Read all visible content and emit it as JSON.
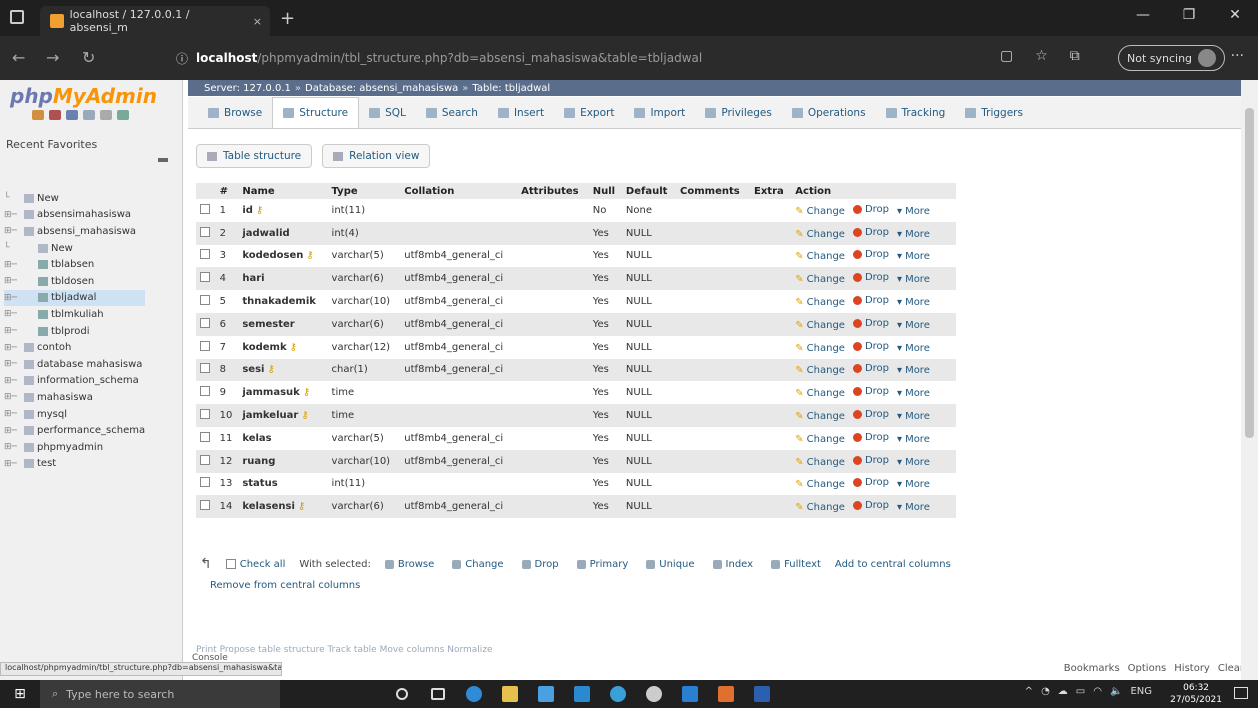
{
  "browser": {
    "tab_title": "localhost / 127.0.0.1 / absensi_m",
    "url_host": "localhost",
    "url_path": "/phpmyadmin/tbl_structure.php?db=absensi_mahasiswa&table=tbljadwal",
    "sync_label": "Not syncing"
  },
  "sidebar": {
    "logo_a": "php",
    "logo_b": "MyAdmin",
    "recent": "Recent",
    "favorites": "Favorites",
    "tree": [
      {
        "label": "New",
        "level": 1,
        "type": "new"
      },
      {
        "label": "absensimahasiswa",
        "level": 1,
        "type": "db"
      },
      {
        "label": "absensi_mahasiswa",
        "level": 1,
        "type": "db"
      },
      {
        "label": "New",
        "level": 2,
        "type": "new"
      },
      {
        "label": "tblabsen",
        "level": 2,
        "type": "tbl"
      },
      {
        "label": "tbldosen",
        "level": 2,
        "type": "tbl"
      },
      {
        "label": "tbljadwal",
        "level": 2,
        "type": "tbl",
        "active": true
      },
      {
        "label": "tblmkuliah",
        "level": 2,
        "type": "tbl"
      },
      {
        "label": "tblprodi",
        "level": 2,
        "type": "tbl"
      },
      {
        "label": "contoh",
        "level": 1,
        "type": "db"
      },
      {
        "label": "database mahasiswa",
        "level": 1,
        "type": "db"
      },
      {
        "label": "information_schema",
        "level": 1,
        "type": "db"
      },
      {
        "label": "mahasiswa",
        "level": 1,
        "type": "db"
      },
      {
        "label": "mysql",
        "level": 1,
        "type": "db"
      },
      {
        "label": "performance_schema",
        "level": 1,
        "type": "db"
      },
      {
        "label": "phpmyadmin",
        "level": 1,
        "type": "db"
      },
      {
        "label": "test",
        "level": 1,
        "type": "db"
      }
    ]
  },
  "breadcrumb": {
    "server": "Server: 127.0.0.1",
    "database": "Database: absensi_mahasiswa",
    "table": "Table: tbljadwal"
  },
  "tabs": [
    "Browse",
    "Structure",
    "SQL",
    "Search",
    "Insert",
    "Export",
    "Import",
    "Privileges",
    "Operations",
    "Tracking",
    "Triggers"
  ],
  "active_tab": "Structure",
  "subtabs": [
    "Table structure",
    "Relation view"
  ],
  "columns": [
    "#",
    "Name",
    "Type",
    "Collation",
    "Attributes",
    "Null",
    "Default",
    "Comments",
    "Extra",
    "Action"
  ],
  "rows": [
    {
      "num": "1",
      "name": "id",
      "key": true,
      "type": "int(11)",
      "collation": "",
      "null": "No",
      "default": "None"
    },
    {
      "num": "2",
      "name": "jadwalid",
      "key": false,
      "type": "int(4)",
      "collation": "",
      "null": "Yes",
      "default": "NULL"
    },
    {
      "num": "3",
      "name": "kodedosen",
      "key": true,
      "type": "varchar(5)",
      "collation": "utf8mb4_general_ci",
      "null": "Yes",
      "default": "NULL"
    },
    {
      "num": "4",
      "name": "hari",
      "key": false,
      "type": "varchar(6)",
      "collation": "utf8mb4_general_ci",
      "null": "Yes",
      "default": "NULL"
    },
    {
      "num": "5",
      "name": "thnakademik",
      "key": false,
      "type": "varchar(10)",
      "collation": "utf8mb4_general_ci",
      "null": "Yes",
      "default": "NULL"
    },
    {
      "num": "6",
      "name": "semester",
      "key": false,
      "type": "varchar(6)",
      "collation": "utf8mb4_general_ci",
      "null": "Yes",
      "default": "NULL"
    },
    {
      "num": "7",
      "name": "kodemk",
      "key": true,
      "type": "varchar(12)",
      "collation": "utf8mb4_general_ci",
      "null": "Yes",
      "default": "NULL"
    },
    {
      "num": "8",
      "name": "sesi",
      "key": true,
      "type": "char(1)",
      "collation": "utf8mb4_general_ci",
      "null": "Yes",
      "default": "NULL"
    },
    {
      "num": "9",
      "name": "jammasuk",
      "key": true,
      "type": "time",
      "collation": "",
      "null": "Yes",
      "default": "NULL"
    },
    {
      "num": "10",
      "name": "jamkeluar",
      "key": true,
      "type": "time",
      "collation": "",
      "null": "Yes",
      "default": "NULL"
    },
    {
      "num": "11",
      "name": "kelas",
      "key": false,
      "type": "varchar(5)",
      "collation": "utf8mb4_general_ci",
      "null": "Yes",
      "default": "NULL"
    },
    {
      "num": "12",
      "name": "ruang",
      "key": false,
      "type": "varchar(10)",
      "collation": "utf8mb4_general_ci",
      "null": "Yes",
      "default": "NULL"
    },
    {
      "num": "13",
      "name": "status",
      "key": false,
      "type": "int(11)",
      "collation": "",
      "null": "Yes",
      "default": "NULL"
    },
    {
      "num": "14",
      "name": "kelasensi",
      "key": true,
      "type": "varchar(6)",
      "collation": "utf8mb4_general_ci",
      "null": "Yes",
      "default": "NULL"
    }
  ],
  "row_actions": {
    "change": "Change",
    "drop": "Drop",
    "more": "More"
  },
  "bottom": {
    "check_all": "Check all",
    "with_selected": "With selected:",
    "actions": [
      "Browse",
      "Change",
      "Drop",
      "Primary",
      "Unique",
      "Index",
      "Fulltext"
    ],
    "add_central": "Add to central columns",
    "remove_central": "Remove from central columns",
    "faded": "Print   Propose table structure   Track table   Move columns   Normalize"
  },
  "console_label": "Console",
  "bookmarks": [
    "Bookmarks",
    "Options",
    "History",
    "Clear"
  ],
  "status_url": "localhost/phpmyadmin/tbl_structure.php?db=absensi_mahasiswa&table=tbljadwal",
  "taskbar": {
    "search_placeholder": "Type here to search",
    "lang": "ENG",
    "time": "06:32",
    "date": "27/05/2021"
  }
}
